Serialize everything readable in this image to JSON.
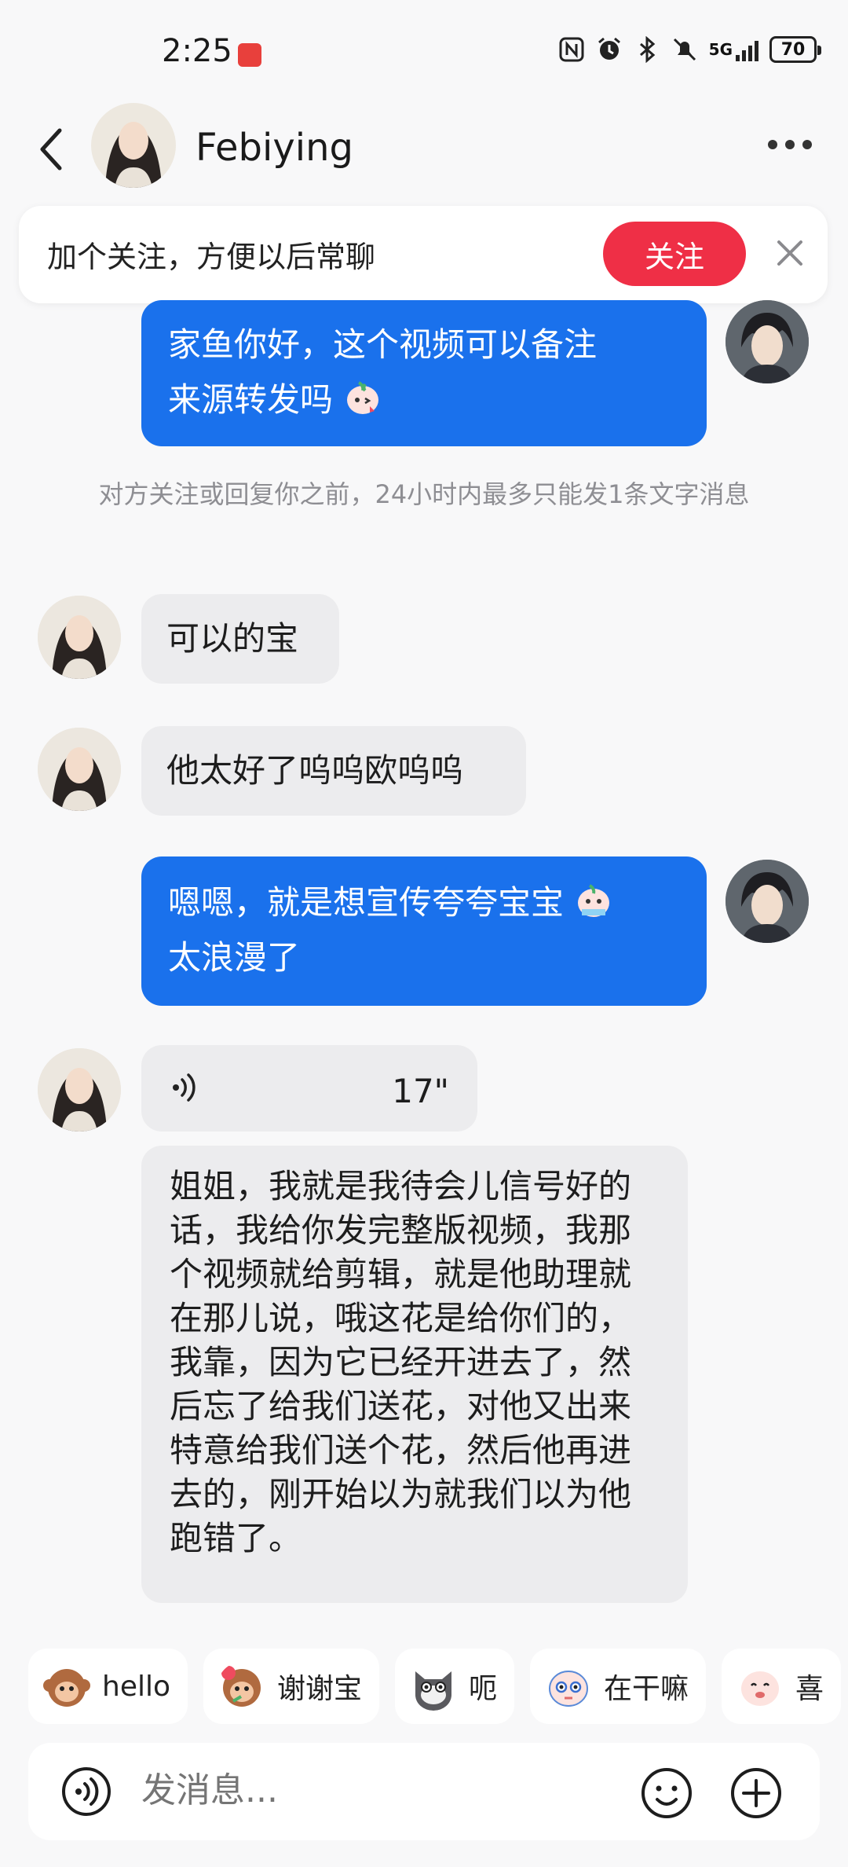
{
  "status_bar": {
    "time": "2:25",
    "network": "5G",
    "battery": "70"
  },
  "header": {
    "contact_name": "Febiying"
  },
  "follow_banner": {
    "text": "加个关注，方便以后常聊",
    "follow_label": "关注"
  },
  "messages": {
    "m1_line1": "家鱼你好，这个视频可以备注",
    "m1_line2": "来源转发吗",
    "notice": "对方关注或回复你之前，24小时内最多只能发1条文字消息",
    "m2": "可以的宝",
    "m3": "他太好了呜呜欧呜呜",
    "m4_line1": "嗯嗯，就是想宣传夸夸宝宝",
    "m4_line2": "太浪漫了",
    "voice_duration": "17\"",
    "voice_transcript": "姐姐，我就是我待会儿信号好的话，我给你发完整版视频，我那个视频就给剪辑，就是他助理就在那儿说，哦这花是给你们的，我靠，因为它已经开进去了，然后忘了给我们送花，对他又出来特意给我们送个花，然后他再进去的，刚开始以为就我们以为他跑错了。"
  },
  "quick_replies": [
    {
      "label": "hello",
      "icon": "monkey-emoji-icon"
    },
    {
      "label": "谢谢宝",
      "icon": "monkey-flower-emoji-icon"
    },
    {
      "label": "呃",
      "icon": "cat-emoji-icon"
    },
    {
      "label": "在干嘛",
      "icon": "peach-emoji-icon"
    },
    {
      "label": "喜",
      "icon": "peach-happy-emoji-icon"
    }
  ],
  "input": {
    "placeholder": "发消息..."
  },
  "colors": {
    "accent_blue": "#1a71ec",
    "follow_red": "#ef2f46",
    "incoming_bubble": "#ececee"
  }
}
